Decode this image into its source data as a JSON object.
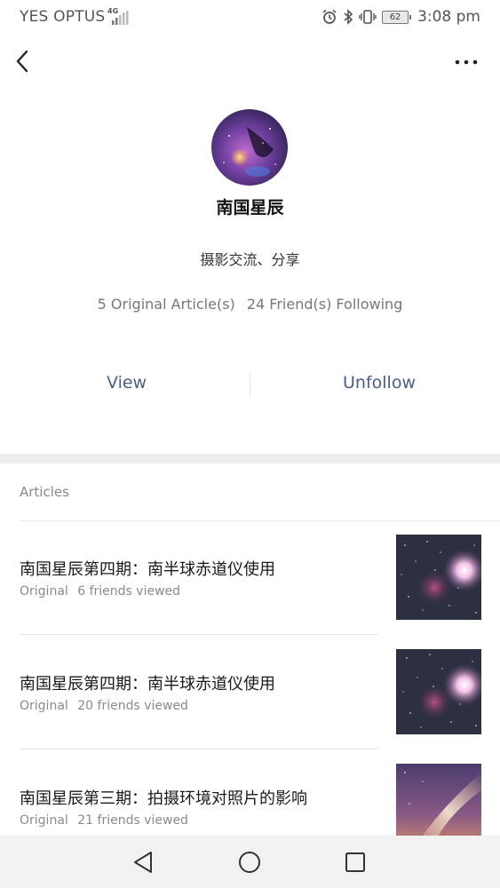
{
  "status_bar": {
    "carrier": "YES OPTUS",
    "network": "4G",
    "battery": "62",
    "time": "3:08 pm",
    "icons": [
      "signal-icon",
      "alarm-icon",
      "bluetooth-icon",
      "vibrate-icon",
      "battery-icon"
    ]
  },
  "header": {
    "back_icon": "chevron-left-icon",
    "more_icon": "more-dots-icon"
  },
  "profile": {
    "name": "南国星辰",
    "bio": "摄影交流、分享",
    "stats": {
      "articles": "5 Original Article(s)",
      "following": "24 Friend(s) Following"
    },
    "actions": {
      "view": "View",
      "unfollow": "Unfollow"
    }
  },
  "articles": {
    "heading": "Articles",
    "items": [
      {
        "title": "南国星辰第四期：南半球赤道仪使用",
        "tag": "Original",
        "views": "6 friends viewed",
        "thumb": "orion-nebula-image"
      },
      {
        "title": "南国星辰第四期：南半球赤道仪使用",
        "tag": "Original",
        "views": "20 friends viewed",
        "thumb": "orion-nebula-image"
      },
      {
        "title": "南国星辰第三期：拍摄环境对照片的影响",
        "tag": "Original",
        "views": "21 friends viewed",
        "thumb": "milky-way-image"
      }
    ]
  },
  "nav_bar": {
    "back": "triangle-back-icon",
    "home": "circle-home-icon",
    "recents": "square-recents-icon"
  },
  "colors": {
    "link": "#4a5d86",
    "muted": "#8a8a8a",
    "section_gap": "#ededed",
    "nav_bg": "#f2f2f2"
  }
}
